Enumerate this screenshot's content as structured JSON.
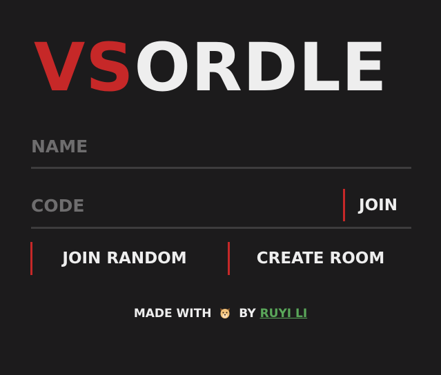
{
  "logo": {
    "prefix": "VS",
    "rest": "ORDLE",
    "prefix_color": "#c62828",
    "rest_color": "#eeeeee"
  },
  "form": {
    "name_placeholder": "NAME",
    "code_placeholder": "CODE",
    "join_label": "JOIN",
    "join_random_label": "JOIN RANDOM",
    "create_room_label": "CREATE ROOM"
  },
  "footer": {
    "made_with": "MADE WITH",
    "icon": "dog-face-icon",
    "by": "BY",
    "author": "RUYI LI",
    "link_color": "#5aa85a"
  },
  "colors": {
    "background": "#1c1b1c",
    "accent": "#c62828",
    "divider": "#3d3c3d",
    "placeholder": "#6e6d6e"
  }
}
